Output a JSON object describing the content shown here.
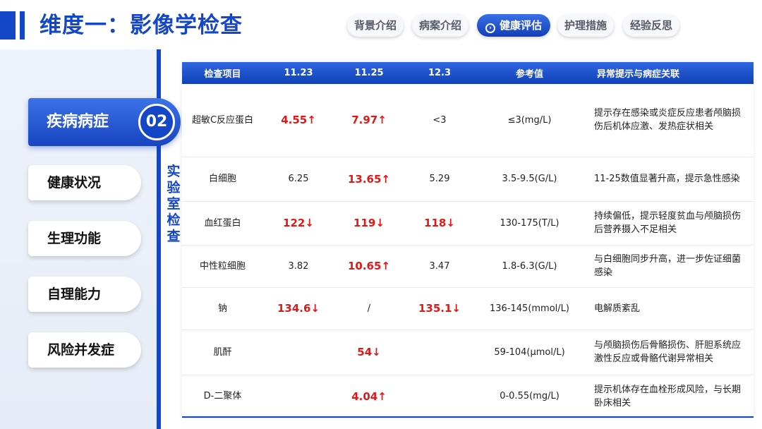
{
  "header": {
    "title": "维度一：影像学检查",
    "nav": [
      {
        "label": "背景介绍",
        "active": false
      },
      {
        "label": "病案介绍",
        "active": false
      },
      {
        "label": "健康评估",
        "active": true
      },
      {
        "label": "护理措施",
        "active": false
      },
      {
        "label": "经验反思",
        "active": false
      }
    ],
    "active_icon": "›"
  },
  "sidebar": {
    "active": {
      "label": "疾病病症",
      "number": "02"
    },
    "items": [
      {
        "label": "健康状况"
      },
      {
        "label": "生理功能"
      },
      {
        "label": "自理能力"
      },
      {
        "label": "风险并发症"
      }
    ]
  },
  "section_label": [
    "实",
    "验",
    "室",
    "检",
    "查"
  ],
  "colors": {
    "primary": "#1447c8",
    "abnormal": "#e01818"
  },
  "table": {
    "headers": [
      "检查项目",
      "11.23",
      "11.25",
      "12.3",
      "参考值",
      "异常提示与病症关联"
    ],
    "rows": [
      {
        "name": "超敏C反应蛋白",
        "v1": "4.55↑",
        "v1_abn": true,
        "v2": "7.97↑",
        "v2_abn": true,
        "v3": "<3",
        "v3_abn": false,
        "ref": "≤3(mg/L)",
        "note": "提示存在感染或炎症反应患者颅脑损伤后机体应激、发热症状相关"
      },
      {
        "name": "白细胞",
        "v1": "6.25",
        "v1_abn": false,
        "v2": "13.65↑",
        "v2_abn": true,
        "v3": "5.29",
        "v3_abn": false,
        "ref": "3.5-9.5(G/L)",
        "note": "11-25数值显著升高，提示急性感染"
      },
      {
        "name": "血红蛋白",
        "v1": "122↓",
        "v1_abn": true,
        "v2": "119↓",
        "v2_abn": true,
        "v3": "118↓",
        "v3_abn": true,
        "ref": "130-175(T/L)",
        "note": "持续偏低，提示轻度贫血与颅脑损伤后营养摄入不足相关"
      },
      {
        "name": "中性粒细胞",
        "v1": "3.82",
        "v1_abn": false,
        "v2": "10.65↑",
        "v2_abn": true,
        "v3": "3.47",
        "v3_abn": false,
        "ref": "1.8-6.3(G/L)",
        "note": "与白细胞同步升高，进一步佐证细菌感染"
      },
      {
        "name": "钠",
        "v1": "134.6↓",
        "v1_abn": true,
        "v2": "/",
        "v2_abn": false,
        "v3": "135.1↓",
        "v3_abn": true,
        "ref": "136-145(mmol/L)",
        "note": "电解质紊乱"
      },
      {
        "name": "肌酐",
        "v1": "",
        "v1_abn": false,
        "v2": "54↓",
        "v2_abn": true,
        "v3": "",
        "v3_abn": false,
        "ref": "59-104(μmol/L)",
        "note": "与颅脑损伤后骨骼损伤、肝胆系统应激性反应或骨骼代谢异常相关"
      },
      {
        "name": "D-二聚体",
        "v1": "",
        "v1_abn": false,
        "v2": "4.04↑",
        "v2_abn": true,
        "v3": "",
        "v3_abn": false,
        "ref": "0-0.55(mg/L)",
        "note": "提示机体存在血栓形成风险，与长期卧床相关"
      }
    ]
  }
}
